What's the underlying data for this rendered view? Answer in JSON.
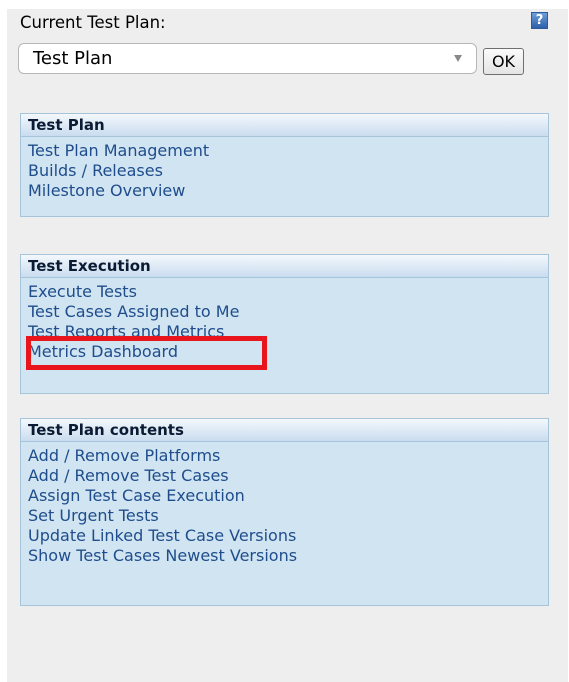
{
  "header": {
    "label": "Current Test Plan:",
    "selected_plan": "Test Plan",
    "ok_label": "OK",
    "help_glyph": "?"
  },
  "sections": [
    {
      "title": "Test Plan",
      "links": [
        "Test Plan Management",
        "Builds / Releases",
        "Milestone Overview"
      ]
    },
    {
      "title": "Test Execution",
      "links": [
        "Execute Tests",
        "Test Cases Assigned to Me",
        "Test Reports and Metrics",
        "Metrics Dashboard"
      ]
    },
    {
      "title": "Test Plan contents",
      "links": [
        "Add / Remove Platforms",
        "Add / Remove Test Cases",
        "Assign Test Case Execution",
        "Set Urgent Tests",
        "Update Linked Test Case Versions",
        "Show Test Cases Newest Versions"
      ]
    }
  ],
  "annotation": {
    "highlighted_item": "Test Reports and Metrics",
    "color": "#e8151d"
  },
  "colors": {
    "link": "#1f4d8c",
    "box_background": "#d0e4f1",
    "panel_background": "#eeeeee"
  }
}
